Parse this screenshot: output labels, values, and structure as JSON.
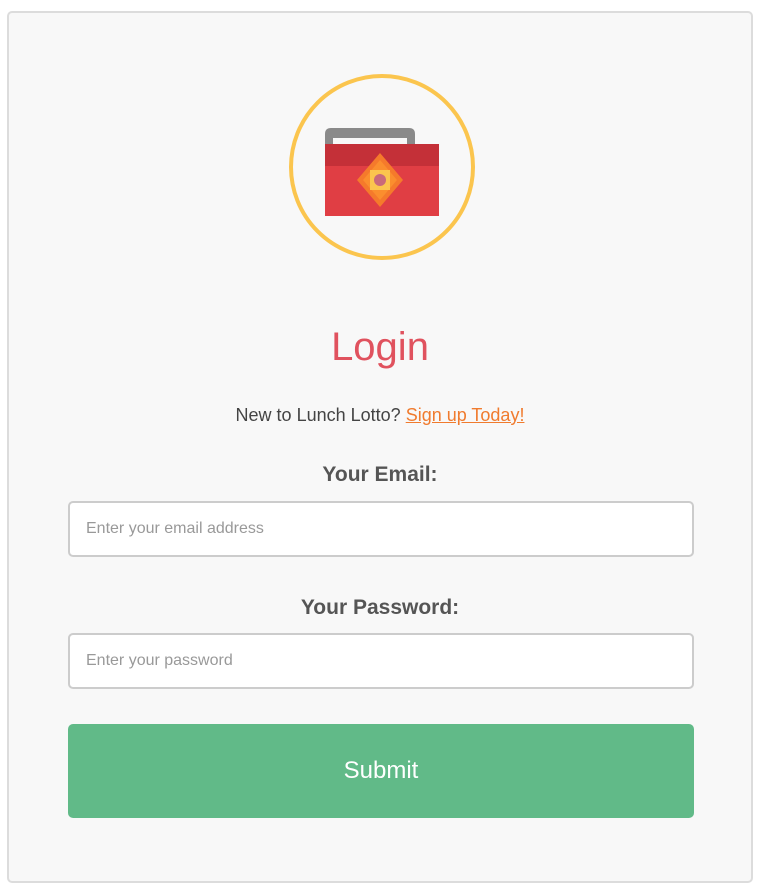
{
  "login": {
    "title": "Login",
    "signup_prompt": "New to Lunch Lotto?",
    "signup_link": "Sign up Today!",
    "email_label": "Your Email:",
    "email_placeholder": "Enter your email address",
    "email_value": "",
    "password_label": "Your Password:",
    "password_placeholder": "Enter your password",
    "password_value": "",
    "submit_label": "Submit"
  },
  "logo": {
    "icon": "toolbox-icon"
  },
  "colors": {
    "page_background": "#f8f8f8",
    "title": "#e0525e",
    "link": "#f07b2e",
    "submit": "#61ba88",
    "logo_ring": "#fbc54e"
  }
}
